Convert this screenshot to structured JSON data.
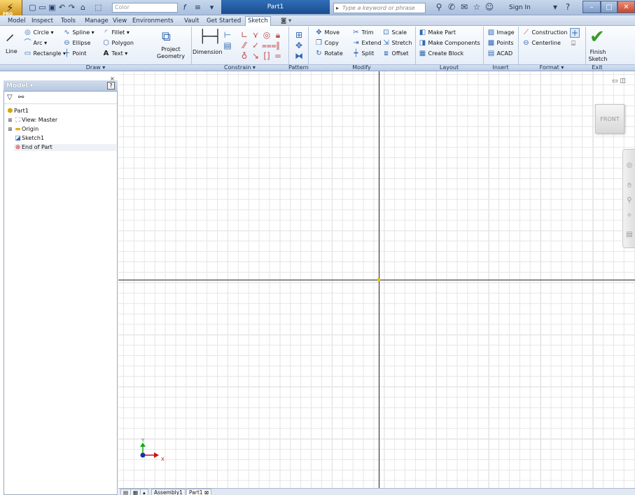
{
  "titlebar": {
    "document_title": "Part1",
    "color_combo": "Color",
    "search_placeholder": "Type a keyword or phrase",
    "sign_in": "Sign In",
    "app_badge": "PRO"
  },
  "menu_tabs": [
    {
      "label": "Model"
    },
    {
      "label": "Inspect"
    },
    {
      "label": "Tools"
    },
    {
      "label": "Manage"
    },
    {
      "label": "View"
    },
    {
      "label": "Environments"
    },
    {
      "label": "Vault"
    },
    {
      "label": "Get Started"
    },
    {
      "label": "Sketch"
    }
  ],
  "ribbon": {
    "draw": {
      "line": "Line",
      "circle": "Circle",
      "arc": "Arc",
      "rectangle": "Rectangle",
      "spline": "Spline",
      "ellipse": "Ellipse",
      "point": "Point",
      "fillet": "Fillet",
      "polygon": "Polygon",
      "text": "Text",
      "project_geometry_1": "Project",
      "project_geometry_2": "Geometry"
    },
    "constrain": {
      "dimension": "Dimension"
    },
    "modify": {
      "move": "Move",
      "copy": "Copy",
      "rotate": "Rotate",
      "trim": "Trim",
      "extend": "Extend",
      "split": "Split",
      "scale": "Scale",
      "stretch": "Stretch",
      "offset": "Offset"
    },
    "layout": {
      "make_part": "Make Part",
      "make_components": "Make Components",
      "create_block": "Create Block"
    },
    "insert": {
      "image": "Image",
      "points": "Points",
      "acad": "ACAD"
    },
    "format": {
      "construction": "Construction",
      "centerline": "Centerline"
    },
    "exit": {
      "finish_1": "Finish",
      "finish_2": "Sketch"
    }
  },
  "panel_labels": {
    "draw": "Draw ▾",
    "constrain": "Constrain ▾",
    "pattern": "Pattern",
    "modify": "Modify",
    "layout": "Layout",
    "insert": "Insert",
    "format": "Format ▾",
    "exit": "Exit"
  },
  "browser": {
    "title": "Model ▾",
    "help": "?",
    "tree": [
      {
        "label": "Part1"
      },
      {
        "label": "View: Master"
      },
      {
        "label": "Origin"
      },
      {
        "label": "Sketch1"
      },
      {
        "label": "End of Part"
      }
    ]
  },
  "viewport": {
    "viewcube_face": "FRONT",
    "axis_y": "Y",
    "axis_x": "X"
  },
  "doc_tabs": [
    {
      "label": "Assembly1"
    },
    {
      "label": "Part1"
    }
  ],
  "colors": {
    "accent": "#1c4c8d",
    "grid": "#e6e6e6",
    "axis_x": "#cc1111",
    "axis_y": "#11aa11"
  }
}
